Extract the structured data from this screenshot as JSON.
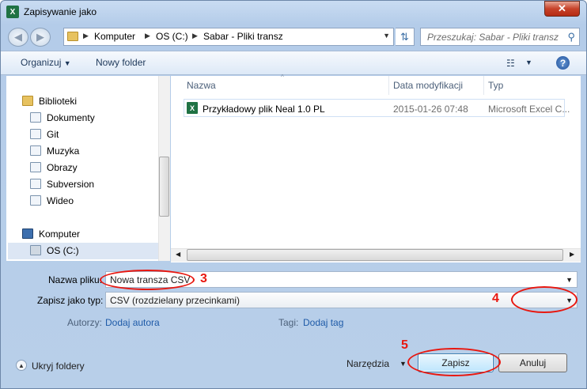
{
  "window": {
    "title": "Zapisywanie jako",
    "app_icon_letter": "X",
    "close_symbol": "✕"
  },
  "address": {
    "crumbs": [
      "Komputer",
      "OS (C:)",
      "Sabar - Pliki transz"
    ],
    "search_placeholder": "Przeszukaj: Sabar - Pliki transz"
  },
  "toolbar": {
    "organize": "Organizuj",
    "new_folder": "Nowy folder",
    "help": "?"
  },
  "nav": {
    "libraries": "Biblioteki",
    "items": [
      "Dokumenty",
      "Git",
      "Muzyka",
      "Obrazy",
      "Subversion",
      "Wideo"
    ],
    "computer": "Komputer",
    "drive": "OS (C:)"
  },
  "files": {
    "columns": [
      "Nazwa",
      "Data modyfikacji",
      "Typ"
    ],
    "rows": [
      {
        "name": "Przykładowy plik Neal 1.0 PL",
        "modified": "2015-01-26 07:48",
        "type": "Microsoft Excel C..."
      }
    ]
  },
  "form": {
    "name_label": "Nazwa pliku:",
    "name_value": "Nowa transza CSV",
    "type_label": "Zapisz jako typ:",
    "type_value": "CSV (rozdzielany przecinkami)",
    "authors_label": "Autorzy:",
    "authors_link": "Dodaj autora",
    "tags_label": "Tagi:",
    "tags_link": "Dodaj tag"
  },
  "footer": {
    "hide_folders": "Ukryj foldery",
    "tools": "Narzędzia",
    "save": "Zapisz",
    "cancel": "Anuluj"
  },
  "annotations": [
    "3",
    "4",
    "5"
  ],
  "colors": {
    "annotation": "#e8170f",
    "accent": "#1e5aa8"
  }
}
